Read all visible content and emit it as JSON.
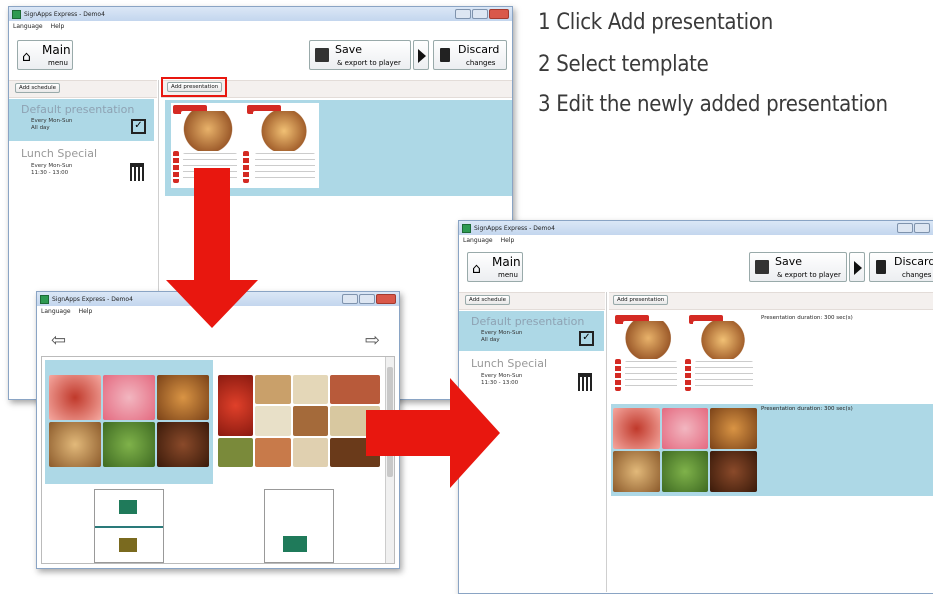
{
  "steps": [
    {
      "num": "1",
      "text": "Click Add presentation"
    },
    {
      "num": "2",
      "text": "Select template"
    },
    {
      "num": "3",
      "text": "Edit the newly added presentation"
    }
  ],
  "app": {
    "title": "SignApps Express - Demo4",
    "menu": [
      "Language",
      "Help"
    ],
    "main_label": "Main",
    "main_sub": "menu",
    "save_label": "Save",
    "save_sub": "& export to player",
    "discard_label": "Discard",
    "discard_sub": "changes",
    "add_schedule": "Add schedule",
    "add_presentation": "Add presentation",
    "schedules": [
      {
        "name": "Default presentation",
        "line1": "Every Mon-Sun",
        "line2": "All day",
        "icon": "checkbox-icon"
      },
      {
        "name": "Lunch Special",
        "line1": "Every Mon-Sun",
        "line2": "11:30 - 13:00",
        "icon": "calendar-icon"
      }
    ],
    "duration_text": "Presentation duration: 300 sec(s)"
  },
  "colors": {
    "accent_red": "#e8170f",
    "selected": "#add8e6",
    "menu_red": "#d42a23"
  }
}
